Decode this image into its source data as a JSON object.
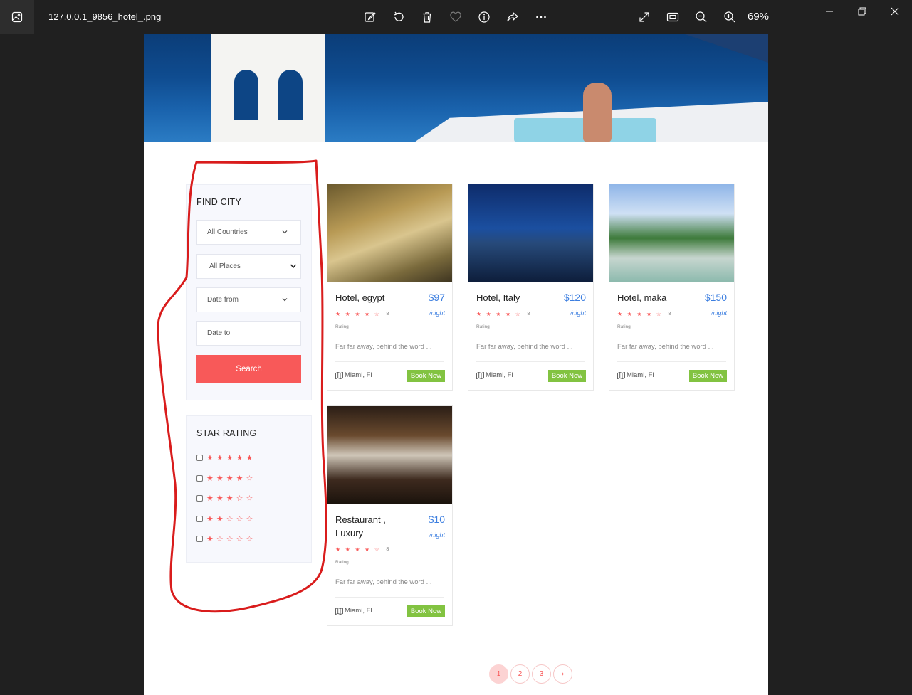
{
  "viewer": {
    "filename": "127.0.0.1_9856_hotel_.png",
    "zoom": "69%",
    "toolbar_icons": [
      "edit-image-icon",
      "rotate-icon",
      "delete-icon",
      "favorite-icon",
      "info-icon",
      "share-icon",
      "more-icon"
    ],
    "view_icons": [
      "fullscreen-icon",
      "fit-window-icon",
      "zoom-out-icon",
      "zoom-in-icon"
    ],
    "window_icons": [
      "minimize-icon",
      "restore-icon",
      "close-icon"
    ]
  },
  "sidebar": {
    "find_city": {
      "title": "FIND CITY",
      "country_select": "All Countries",
      "place_select": "All Places",
      "date_from": "Date from",
      "date_to": "Date to",
      "search_label": "Search"
    },
    "star_rating": {
      "title": "STAR RATING",
      "rows": [
        {
          "stars": 5,
          "glyphs": "★★★★★"
        },
        {
          "stars": 4,
          "glyphs": "★★★★☆"
        },
        {
          "stars": 3,
          "glyphs": "★★★☆☆"
        },
        {
          "stars": 2,
          "glyphs": "★★☆☆☆"
        },
        {
          "stars": 1,
          "glyphs": "★☆☆☆☆"
        }
      ]
    }
  },
  "hotels": [
    {
      "name": "Hotel, egypt",
      "price": "$97",
      "per": "/night",
      "rating_glyphs": "★★★★☆",
      "rating_count": "8",
      "rating_label": "Rating",
      "description": "Far far away, behind the word ...",
      "location": "Miami, Fl",
      "book_label": "Book Now"
    },
    {
      "name": "Hotel, Italy",
      "price": "$120",
      "per": "/night",
      "rating_glyphs": "★★★★☆",
      "rating_count": "8",
      "rating_label": "Rating",
      "description": "Far far away, behind the word ...",
      "location": "Miami, Fl",
      "book_label": "Book Now"
    },
    {
      "name": "Hotel, maka",
      "price": "$150",
      "per": "/night",
      "rating_glyphs": "★★★★☆",
      "rating_count": "8",
      "rating_label": "Rating",
      "description": "Far far away, behind the word ...",
      "location": "Miami, Fl",
      "book_label": "Book Now"
    },
    {
      "name": "Restaurant , Luxury",
      "price": "$10",
      "per": "/night",
      "rating_glyphs": "★★★★☆",
      "rating_count": "8",
      "rating_label": "Rating",
      "description": "Far far away, behind the word ...",
      "location": "Miami, Fl",
      "book_label": "Book Now"
    }
  ],
  "pagination": {
    "pages": [
      "1",
      "2",
      "3"
    ],
    "next": "›",
    "active": "1"
  },
  "colors": {
    "accent": "#f85959",
    "price": "#3d7fe0",
    "book": "#82c341",
    "annotation": "#d91c1c"
  }
}
